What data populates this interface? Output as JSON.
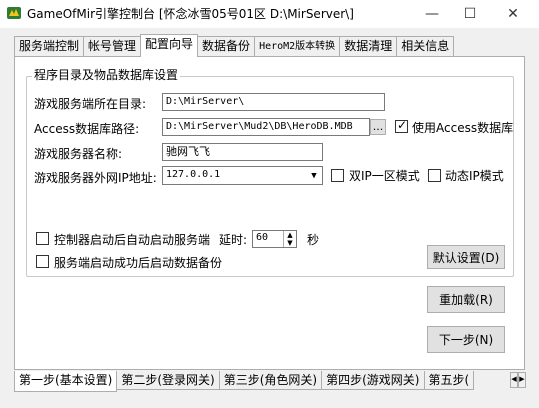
{
  "window": {
    "title": "GameOfMir引擎控制台 [怀念冰雪05号01区 D:\\MirServer\\]",
    "minimize": "—",
    "maximize": "☐",
    "close": "✕",
    "icon": "app-logo-icon"
  },
  "top_tabs": [
    "服务端控制",
    "帐号管理",
    "配置向导",
    "数据备份",
    "HeroM2版本转换",
    "数据清理",
    "相关信息"
  ],
  "active_top_tab": "配置向导",
  "group": {
    "title": "程序目录及物品数据库设置",
    "server_dir_label": "游戏服务端所在目录:",
    "server_dir_value": "D:\\MirServer\\",
    "access_path_label": "Access数据库路径:",
    "access_path_value": "D:\\MirServer\\Mud2\\DB\\HeroDB.MDB",
    "browse_button": "...",
    "use_access_label": "使用Access数据库",
    "use_access_checked": true,
    "server_name_label": "游戏服务器名称:",
    "server_name_value": "驰网飞飞",
    "external_ip_label": "游戏服务器外网IP地址:",
    "external_ip_value": "127.0.0.1",
    "dual_ip_label": "双IP一区模式",
    "dual_ip_checked": false,
    "dynamic_ip_label": "动态IP模式",
    "dynamic_ip_checked": false,
    "autostart_label": "控制器启动后自动启动服务端",
    "autostart_checked": false,
    "delay_label": "延时:",
    "delay_value": "60",
    "delay_unit": "秒",
    "auto_backup_label": "服务端启动成功后启动数据备份",
    "auto_backup_checked": false,
    "default_button": "默认设置(D)"
  },
  "reload_button": "重加载(R)",
  "next_button": "下一步(N)",
  "bottom_tabs": [
    "第一步(基本设置)",
    "第二步(登录网关)",
    "第三步(角色网关)",
    "第四步(游戏网关)",
    "第五步("
  ],
  "active_bottom_tab": "第一步(基本设置)"
}
